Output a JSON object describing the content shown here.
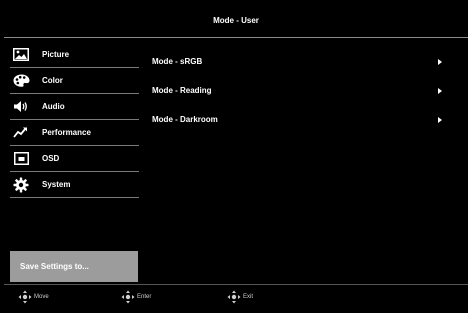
{
  "header": {
    "title": "Mode - User"
  },
  "sidebar": {
    "items": [
      {
        "label": "Picture",
        "icon": "picture-icon"
      },
      {
        "label": "Color",
        "icon": "palette-icon"
      },
      {
        "label": "Audio",
        "icon": "speaker-icon"
      },
      {
        "label": "Performance",
        "icon": "performance-icon"
      },
      {
        "label": "OSD",
        "icon": "osd-icon"
      },
      {
        "label": "System",
        "icon": "gear-icon"
      }
    ],
    "save_label": "Save Settings to..."
  },
  "main": {
    "modes": [
      {
        "label": "Mode - sRGB"
      },
      {
        "label": "Mode - Reading"
      },
      {
        "label": "Mode - Darkroom"
      }
    ]
  },
  "footer": {
    "hints": [
      {
        "label": "Move",
        "icon": "dpad-icon"
      },
      {
        "label": "Enter",
        "icon": "dpad-icon"
      },
      {
        "label": "Exit",
        "icon": "dpad-icon"
      }
    ]
  },
  "colors": {
    "background": "#000000",
    "save_button": "#9c9c9c",
    "divider": "#7a7a7a",
    "text": "#ffffff"
  }
}
